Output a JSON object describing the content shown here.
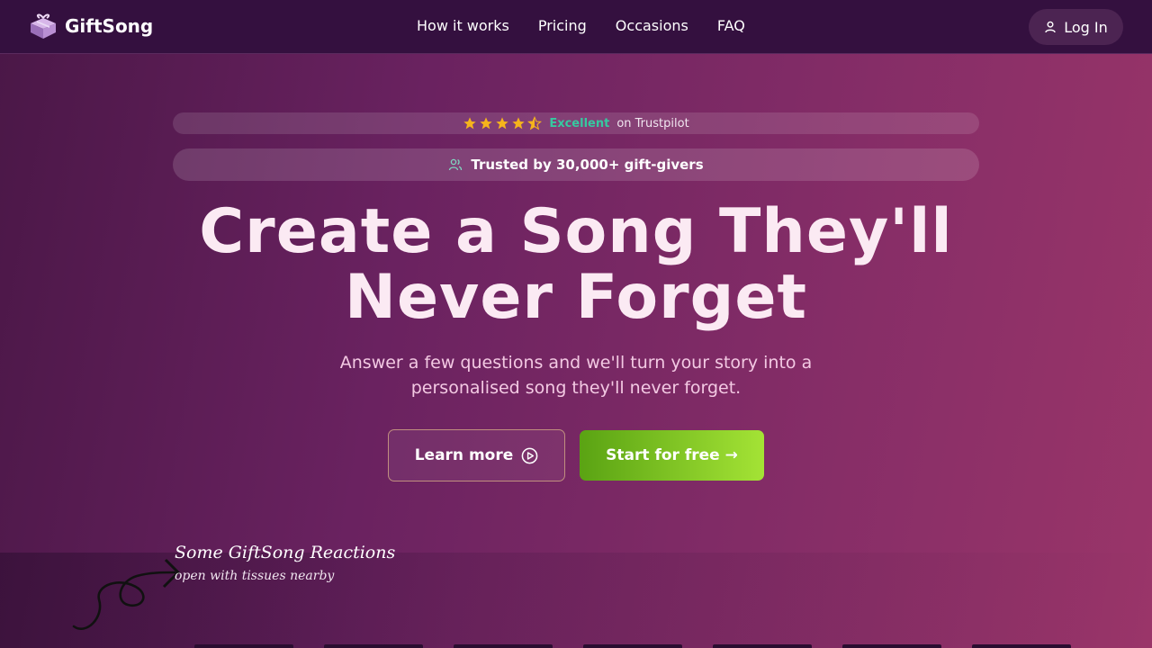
{
  "header": {
    "brand": "GiftSong",
    "nav": [
      "How it works",
      "Pricing",
      "Occasions",
      "FAQ"
    ],
    "login_label": "Log In"
  },
  "rating": {
    "stars": 4.5,
    "label": "Excellent",
    "source": "on Trustpilot"
  },
  "trusted_label": "Trusted by 30,000+ gift-givers",
  "hero": {
    "title_line1": "Create a Song They'll",
    "title_line2": "Never Forget",
    "subtitle_line1": "Answer a few questions and we'll turn your story into a",
    "subtitle_line2": "personalised song they'll never forget."
  },
  "buttons": {
    "learn_more": "Learn more",
    "start": "Start for free →"
  },
  "reactions": {
    "title": "Some GiftSong Reactions",
    "subtitle": "open with tissues nearby"
  },
  "colors": {
    "header_bg": "#34103f",
    "accent_green": "#8fd22b",
    "trustpilot_green": "#36c9a0",
    "star_gold": "#f5b41c"
  }
}
